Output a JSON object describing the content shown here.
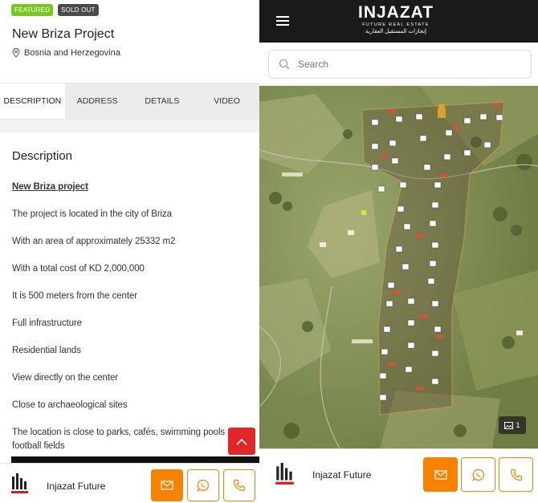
{
  "left": {
    "badges": {
      "featured": "FEATURED",
      "sold_out": "SOLD OUT"
    },
    "title": "New Briza Project",
    "location": "Bosnia and Herzegovina",
    "tabs": [
      "DESCRIPTION",
      "ADDRESS",
      "DETAILS",
      "VIDEO"
    ],
    "section_title": "Description",
    "description": [
      "New Briza project",
      "The project is located in the city of Briza",
      "With an area of approximately 25332 m2",
      "With a total cost of KD 2,000,000",
      "It is 500 meters from the center",
      "Full infrastructure",
      "Residential lands",
      "View directly on the center",
      "Close to archaeological sites",
      "The location is close to parks, cafés, swimming pools and football fields"
    ],
    "agent_name": "Injazat Future"
  },
  "right": {
    "brand": {
      "name": "INJAZAT",
      "tagline": "FUTURE REAL ESTATE",
      "arabic": "إنجازات المستقبل العقارية"
    },
    "search_placeholder": "Search",
    "gallery_count": "1",
    "agent_name": "Injazat Future"
  },
  "icons": {
    "location": "map-pin-icon",
    "email": "envelope-icon",
    "whatsapp": "whatsapp-icon",
    "phone": "phone-icon",
    "scroll_top": "chevron-up-icon",
    "menu": "hamburger-icon",
    "search": "search-icon",
    "gallery": "image-icon"
  },
  "colors": {
    "featured": "#77c720",
    "sold_out": "#4a4a4a",
    "accent": "#f78200",
    "scroll_top": "#e2262a",
    "header": "#1a1a1a"
  }
}
